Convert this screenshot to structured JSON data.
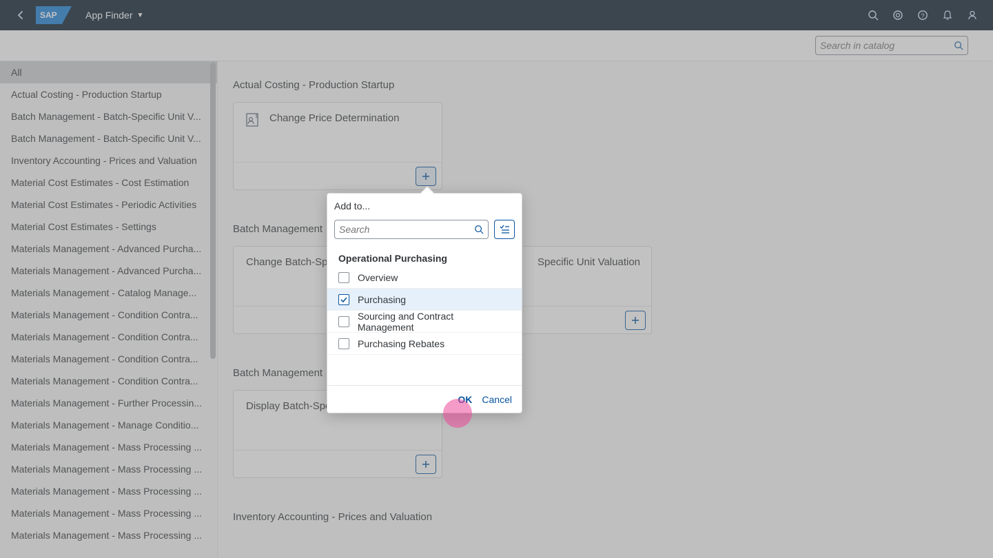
{
  "header": {
    "title": "App Finder"
  },
  "catalog_search": {
    "placeholder": "Search in catalog"
  },
  "sidebar": {
    "items": [
      {
        "label": "All",
        "selected": true
      },
      {
        "label": "Actual Costing - Production Startup"
      },
      {
        "label": "Batch Management - Batch-Specific Unit V..."
      },
      {
        "label": "Batch Management - Batch-Specific Unit V..."
      },
      {
        "label": "Inventory Accounting - Prices and Valuation"
      },
      {
        "label": "Material Cost Estimates - Cost Estimation"
      },
      {
        "label": "Material Cost Estimates - Periodic Activities"
      },
      {
        "label": "Material Cost Estimates - Settings"
      },
      {
        "label": "Materials Management - Advanced Purcha..."
      },
      {
        "label": "Materials Management - Advanced Purcha..."
      },
      {
        "label": "Materials Management - Catalog Manage..."
      },
      {
        "label": "Materials Management - Condition Contra..."
      },
      {
        "label": "Materials Management - Condition Contra..."
      },
      {
        "label": "Materials Management - Condition Contra..."
      },
      {
        "label": "Materials Management - Condition Contra..."
      },
      {
        "label": "Materials Management - Further Processin..."
      },
      {
        "label": "Materials Management - Manage Conditio..."
      },
      {
        "label": "Materials Management - Mass Processing ..."
      },
      {
        "label": "Materials Management - Mass Processing ..."
      },
      {
        "label": "Materials Management - Mass Processing ..."
      },
      {
        "label": "Materials Management - Mass Processing ..."
      },
      {
        "label": "Materials Management - Mass Processing ..."
      }
    ]
  },
  "sections": [
    {
      "title": "Actual Costing - Production Startup",
      "tiles": [
        {
          "title": "Change Price Determination",
          "has_icon": true
        }
      ]
    },
    {
      "title": "Batch Management",
      "tiles": [
        {
          "title": "Change Batch-Sp"
        },
        {
          "title": "Specific Unit Valuation"
        }
      ]
    },
    {
      "title": "Batch Management",
      "tiles": [
        {
          "title": "Display Batch-Specific Unit Valuation"
        }
      ]
    },
    {
      "title": "Inventory Accounting - Prices and Valuation",
      "tiles": []
    }
  ],
  "popover": {
    "title": "Add to...",
    "search_placeholder": "Search",
    "group_label": "Operational Purchasing",
    "items": [
      {
        "label": "Overview",
        "checked": false
      },
      {
        "label": "Purchasing",
        "checked": true
      },
      {
        "label": "Sourcing and Contract Management",
        "checked": false
      },
      {
        "label": "Purchasing Rebates",
        "checked": false
      }
    ],
    "ok_label": "OK",
    "cancel_label": "Cancel"
  }
}
